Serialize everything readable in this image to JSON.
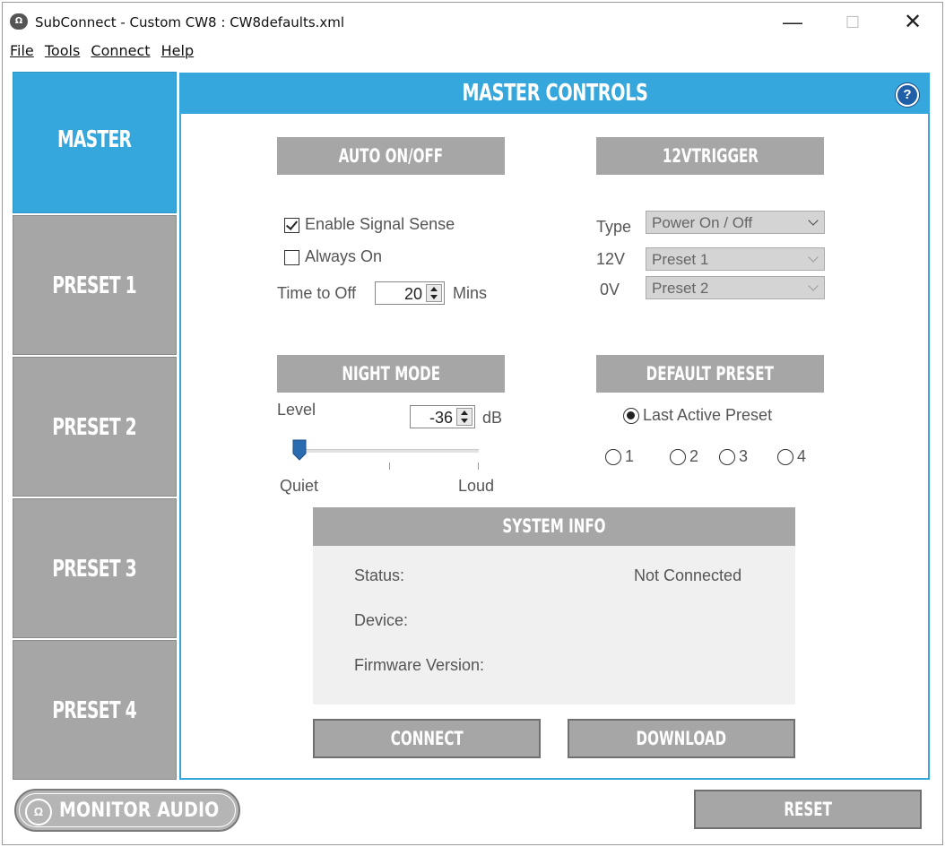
{
  "window": {
    "title": "SubConnect - Custom CW8 : CW8defaults.xml",
    "app_icon_text": "Ω",
    "minimize": "—",
    "maximize": "☐",
    "close": "✕"
  },
  "menu": [
    "File",
    "Tools",
    "Connect",
    "Help"
  ],
  "sidebar": {
    "items": [
      {
        "label": "MASTER",
        "active": true
      },
      {
        "label": "PRESET 1",
        "active": false
      },
      {
        "label": "PRESET 2",
        "active": false
      },
      {
        "label": "PRESET 3",
        "active": false
      },
      {
        "label": "PRESET 4",
        "active": false
      }
    ]
  },
  "main": {
    "title": "MASTER CONTROLS",
    "help_icon": "?"
  },
  "auto_onoff": {
    "heading": "AUTO ON/OFF",
    "enable_signal_sense": {
      "label": "Enable Signal Sense",
      "checked": true
    },
    "always_on": {
      "label": "Always On",
      "checked": false
    },
    "time_to_off_label": "Time to Off",
    "time_to_off_value": "20",
    "time_unit": "Mins"
  },
  "trigger": {
    "heading": "12VTRIGGER",
    "type_label": "Type",
    "type_value": "Power On / Off",
    "v12_label": "12V",
    "v12_value": "Preset 1",
    "v0_label": "0V",
    "v0_value": "Preset 2"
  },
  "night_mode": {
    "heading": "NIGHT MODE",
    "level_label": "Level",
    "level_value": "-36",
    "unit": "dB",
    "slider_min_label": "Quiet",
    "slider_max_label": "Loud",
    "slider_fraction": 0.0
  },
  "default_preset": {
    "heading": "DEFAULT PRESET",
    "last_active_label": "Last Active Preset",
    "selected": "last_active",
    "options": [
      "1",
      "2",
      "3",
      "4"
    ]
  },
  "system_info": {
    "heading": "SYSTEM INFO",
    "status_label": "Status:",
    "status_value": "Not Connected",
    "device_label": "Device:",
    "device_value": "",
    "firmware_label": "Firmware Version:",
    "firmware_value": ""
  },
  "buttons": {
    "connect": "CONNECT",
    "download": "DOWNLOAD",
    "reset": "RESET"
  },
  "logo": {
    "mark": "Ω",
    "text": "MONITOR AUDIO"
  },
  "colors": {
    "accent": "#36a7dc",
    "section_gray": "#a6a6a6",
    "help_blue": "#1f5fa8",
    "slider_thumb": "#2b6cb0"
  }
}
